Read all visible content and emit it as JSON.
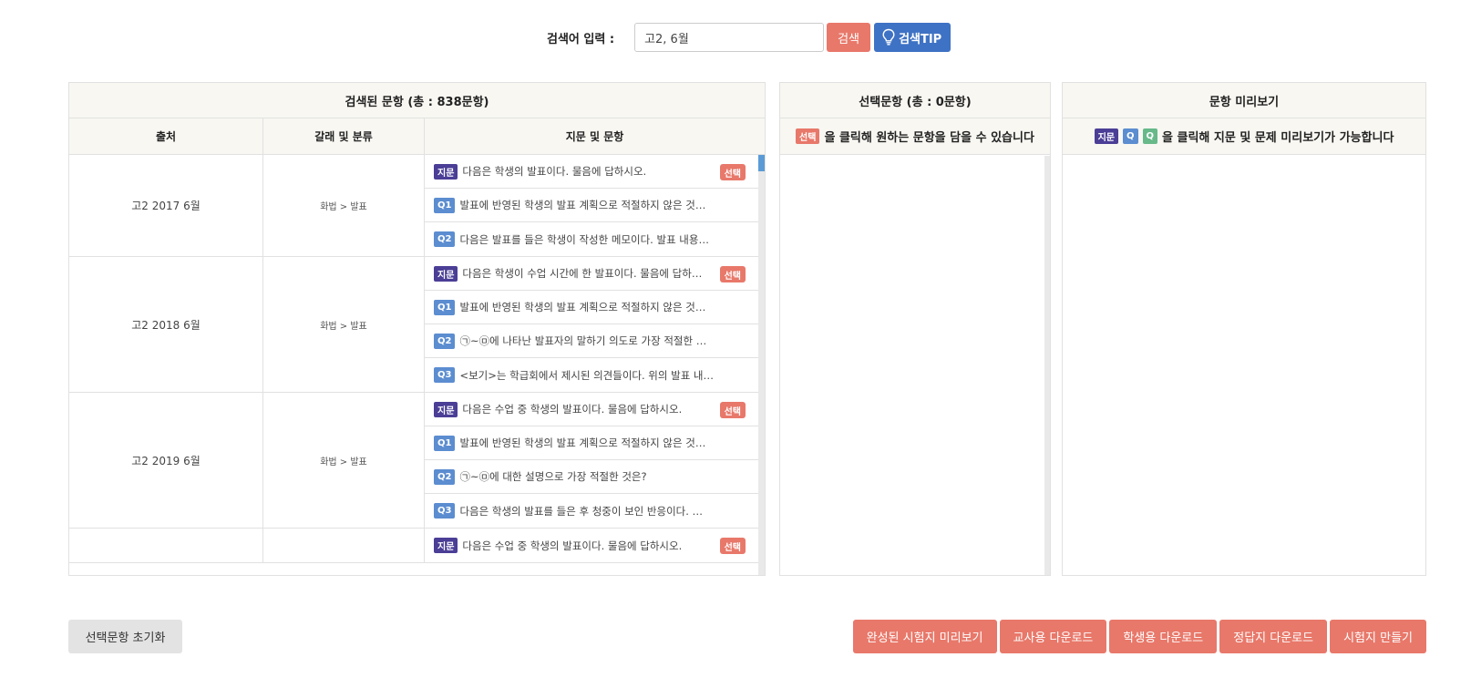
{
  "search": {
    "label": "검색어 입력 :",
    "value": "고2, 6월",
    "search_button": "검색",
    "tip_button": "검색TIP"
  },
  "colors": {
    "accent": "#e8786a",
    "primary": "#3e72c4",
    "passage_badge": "#4a3e96",
    "q_badge": "#5b8dd0",
    "q_badge_green": "#67b98a"
  },
  "search_panel": {
    "title": "검색된 문항 (총 : 838문항)",
    "columns": [
      "출처",
      "갈래 및 분류",
      "지문 및 문항"
    ],
    "groups": [
      {
        "source": "고2 2017 6월",
        "category": "화법 > 발표",
        "rows": [
          {
            "badge": "지문",
            "text": "다음은 학생의 발표이다. 물음에 답하시오.",
            "select": "선택"
          },
          {
            "badge": "Q1",
            "text": "발표에 반영된 학생의 발표 계획으로 적절하지 않은 것…"
          },
          {
            "badge": "Q2",
            "text": "다음은 발표를 들은 학생이 작성한 메모이다. 발표 내용…"
          }
        ]
      },
      {
        "source": "고2 2018 6월",
        "category": "화법 > 발표",
        "rows": [
          {
            "badge": "지문",
            "text": "다음은 학생이 수업 시간에 한 발표이다. 물음에 답하…",
            "select": "선택"
          },
          {
            "badge": "Q1",
            "text": "발표에 반영된 학생의 발표 계획으로 적절하지 않은 것…"
          },
          {
            "badge": "Q2",
            "text": "㉠~㉤에 나타난 발표자의 말하기 의도로 가장 적절한 …"
          },
          {
            "badge": "Q3",
            "text": "<보기>는 학급회에서 제시된 의견들이다. 위의 발표 내…"
          }
        ]
      },
      {
        "source": "고2 2019 6월",
        "category": "화법 > 발표",
        "rows": [
          {
            "badge": "지문",
            "text": "다음은 수업 중 학생의 발표이다. 물음에 답하시오.",
            "select": "선택"
          },
          {
            "badge": "Q1",
            "text": "발표에 반영된 학생의 발표 계획으로 적절하지 않은 것…"
          },
          {
            "badge": "Q2",
            "text": "㉠~㉤에 대한 설명으로 가장 적절한 것은?"
          },
          {
            "badge": "Q3",
            "text": "다음은 학생의 발표를 들은 후 청중이 보인 반응이다. …"
          }
        ]
      },
      {
        "source": "",
        "category": "",
        "rows": [
          {
            "badge": "지문",
            "text": "다음은 수업 중 학생의 발표이다. 물음에 답하시오.",
            "select": "선택"
          }
        ]
      }
    ]
  },
  "selected_panel": {
    "title": "선택문항 (총 : 0문항)",
    "hint_badge": "선택",
    "hint": "을 클릭해 원하는 문항을 담을 수 있습니다"
  },
  "preview_panel": {
    "title": "문항 미리보기",
    "badge_passage": "지문",
    "badge_q1": "Q",
    "badge_q2": "Q",
    "hint": "을 클릭해 지문 및 문제 미리보기가 가능합니다"
  },
  "bottom": {
    "reset": "선택문항 초기화",
    "actions": [
      "완성된 시험지 미리보기",
      "교사용 다운로드",
      "학생용 다운로드",
      "정답지 다운로드",
      "시험지 만들기"
    ]
  }
}
